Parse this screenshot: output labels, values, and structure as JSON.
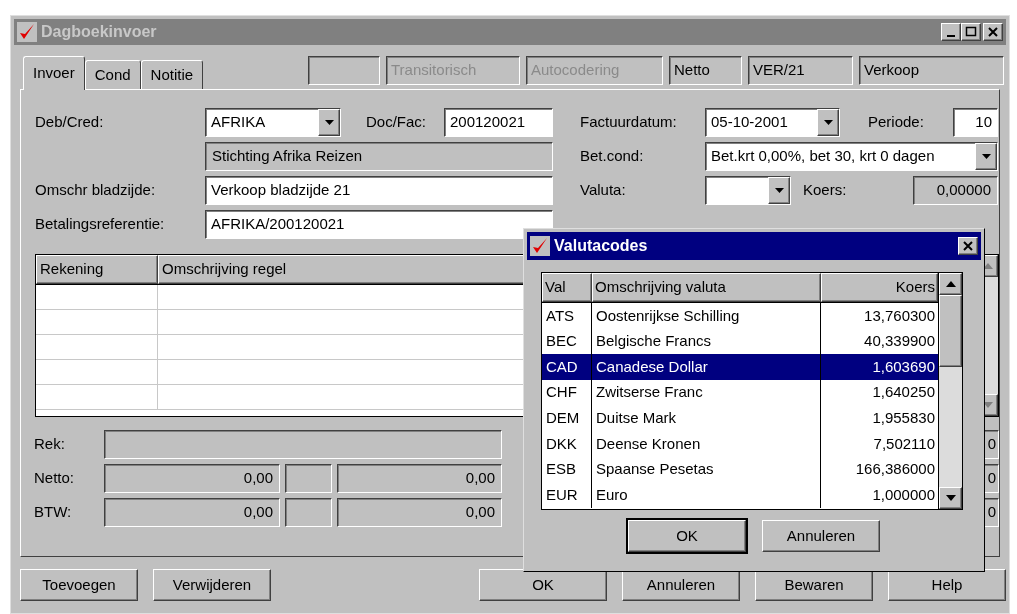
{
  "window": {
    "title": "Dagboekinvoer"
  },
  "tabs": [
    {
      "label": "Invoer",
      "selected": true
    },
    {
      "label": "Cond",
      "selected": false
    },
    {
      "label": "Notitie",
      "selected": false
    }
  ],
  "header_fields": [
    {
      "value": "Transitorisch",
      "disabled": true
    },
    {
      "value": "Autocodering",
      "disabled": true
    },
    {
      "value": "Netto",
      "disabled": false
    },
    {
      "value": "VER/21",
      "disabled": false
    },
    {
      "value": "Verkoop",
      "disabled": false
    }
  ],
  "form": {
    "deb_cred": {
      "label": "Deb/Cred:",
      "value": "AFRIKA"
    },
    "doc_fac": {
      "label": "Doc/Fac:",
      "value": "200120021"
    },
    "name": "Stichting Afrika Reizen",
    "omschr": {
      "label": "Omschr bladzijde:",
      "value": "Verkoop bladzijde 21"
    },
    "betref": {
      "label": "Betalingsreferentie:",
      "value": "AFRIKA/200120021"
    },
    "factuurdatum": {
      "label": "Factuurdatum:",
      "value": "05-10-2001"
    },
    "periode": {
      "label": "Periode:",
      "value": "10"
    },
    "betcond": {
      "label": "Bet.cond:",
      "value": "Bet.krt 0,00%, bet 30, krt 0 dagen"
    },
    "valuta": {
      "label": "Valuta:"
    },
    "koers": {
      "label": "Koers:",
      "value": "0,00000"
    }
  },
  "table": {
    "columns": [
      "Rekening",
      "Omschrijving regel"
    ]
  },
  "totals": [
    {
      "kind": "single",
      "label": "Rek:",
      "edge": "0"
    },
    {
      "kind": "split",
      "label": "Netto:",
      "amount": "0,00",
      "amount_2": "0,00",
      "edge": "0"
    },
    {
      "kind": "split",
      "label": "BTW:",
      "amount": "0,00",
      "amount_2": "0,00",
      "edge": "0"
    }
  ],
  "buttons": [
    "Toevoegen",
    "Verwijderen",
    "OK",
    "Annuleren",
    "Bewaren",
    "Help"
  ],
  "dialog": {
    "title": "Valutacodes",
    "columns": [
      "Val",
      "Omschrijving valuta",
      "Koers"
    ],
    "rows": [
      {
        "code": "ATS",
        "name": "Oostenrijkse Schilling",
        "rate": "13,760300",
        "selected": false
      },
      {
        "code": "BEC",
        "name": "Belgische Francs",
        "rate": "40,339900",
        "selected": false
      },
      {
        "code": "CAD",
        "name": "Canadese Dollar",
        "rate": "1,603690",
        "selected": true
      },
      {
        "code": "CHF",
        "name": "Zwitserse Franc",
        "rate": "1,640250",
        "selected": false
      },
      {
        "code": "DEM",
        "name": "Duitse Mark",
        "rate": "1,955830",
        "selected": false
      },
      {
        "code": "DKK",
        "name": "Deense Kronen",
        "rate": "7,502110",
        "selected": false
      },
      {
        "code": "ESB",
        "name": "Spaanse Pesetas",
        "rate": "166,386000",
        "selected": false
      },
      {
        "code": "EUR",
        "name": "Euro",
        "rate": "1,000000",
        "selected": false
      }
    ],
    "buttons": [
      {
        "label": "OK",
        "default": true
      },
      {
        "label": "Annuleren",
        "default": false
      }
    ]
  }
}
